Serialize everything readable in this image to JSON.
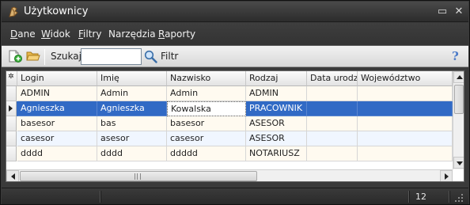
{
  "window": {
    "title": "Użytkownicy",
    "minimize_glyph": "▭",
    "close_glyph": "✕"
  },
  "menu": {
    "items": [
      {
        "label_first": "D",
        "label_rest": "ane"
      },
      {
        "label_first": "W",
        "label_rest": "idok"
      },
      {
        "label_first": "F",
        "label_rest": "iltry"
      },
      {
        "label_first": "",
        "label_rest": "Narzędzia"
      },
      {
        "label_first": "R",
        "label_rest": "aporty"
      }
    ]
  },
  "toolbar": {
    "search_label": "Szukaj",
    "search_value": "",
    "filter_label": "Filtr",
    "help_glyph": "?",
    "icons": [
      "add-icon",
      "open-folder-icon",
      "search-icon",
      "help-icon"
    ]
  },
  "grid": {
    "corner_glyph": "✲",
    "columns": [
      "Login",
      "Imię",
      "Nazwisko",
      "Rodzaj",
      "Data urodze",
      "Województwo"
    ],
    "rows": [
      [
        "ADMIN",
        "Admin",
        "Admin",
        "ADMIN",
        "",
        ""
      ],
      [
        "Agnieszka",
        "Agnieszka",
        "Kowalska",
        "PRACOWNIK",
        "",
        ""
      ],
      [
        "basesor",
        "bas",
        "basesor",
        "ASESOR",
        "",
        ""
      ],
      [
        "casesor",
        "asesor",
        "casesor",
        "ASESOR",
        "",
        ""
      ],
      [
        "dddd",
        "dddd",
        "ddddd",
        "NOTARIUSZ",
        "",
        ""
      ]
    ],
    "selected_row": 1,
    "scroll_grip_glyph": "|||"
  },
  "status": {
    "count": "12"
  },
  "colors": {
    "selection": "#316ac5",
    "row_even": "#fffaf0",
    "row_odd": "#f0f6ff",
    "title_bar": "#3a3a3a"
  }
}
